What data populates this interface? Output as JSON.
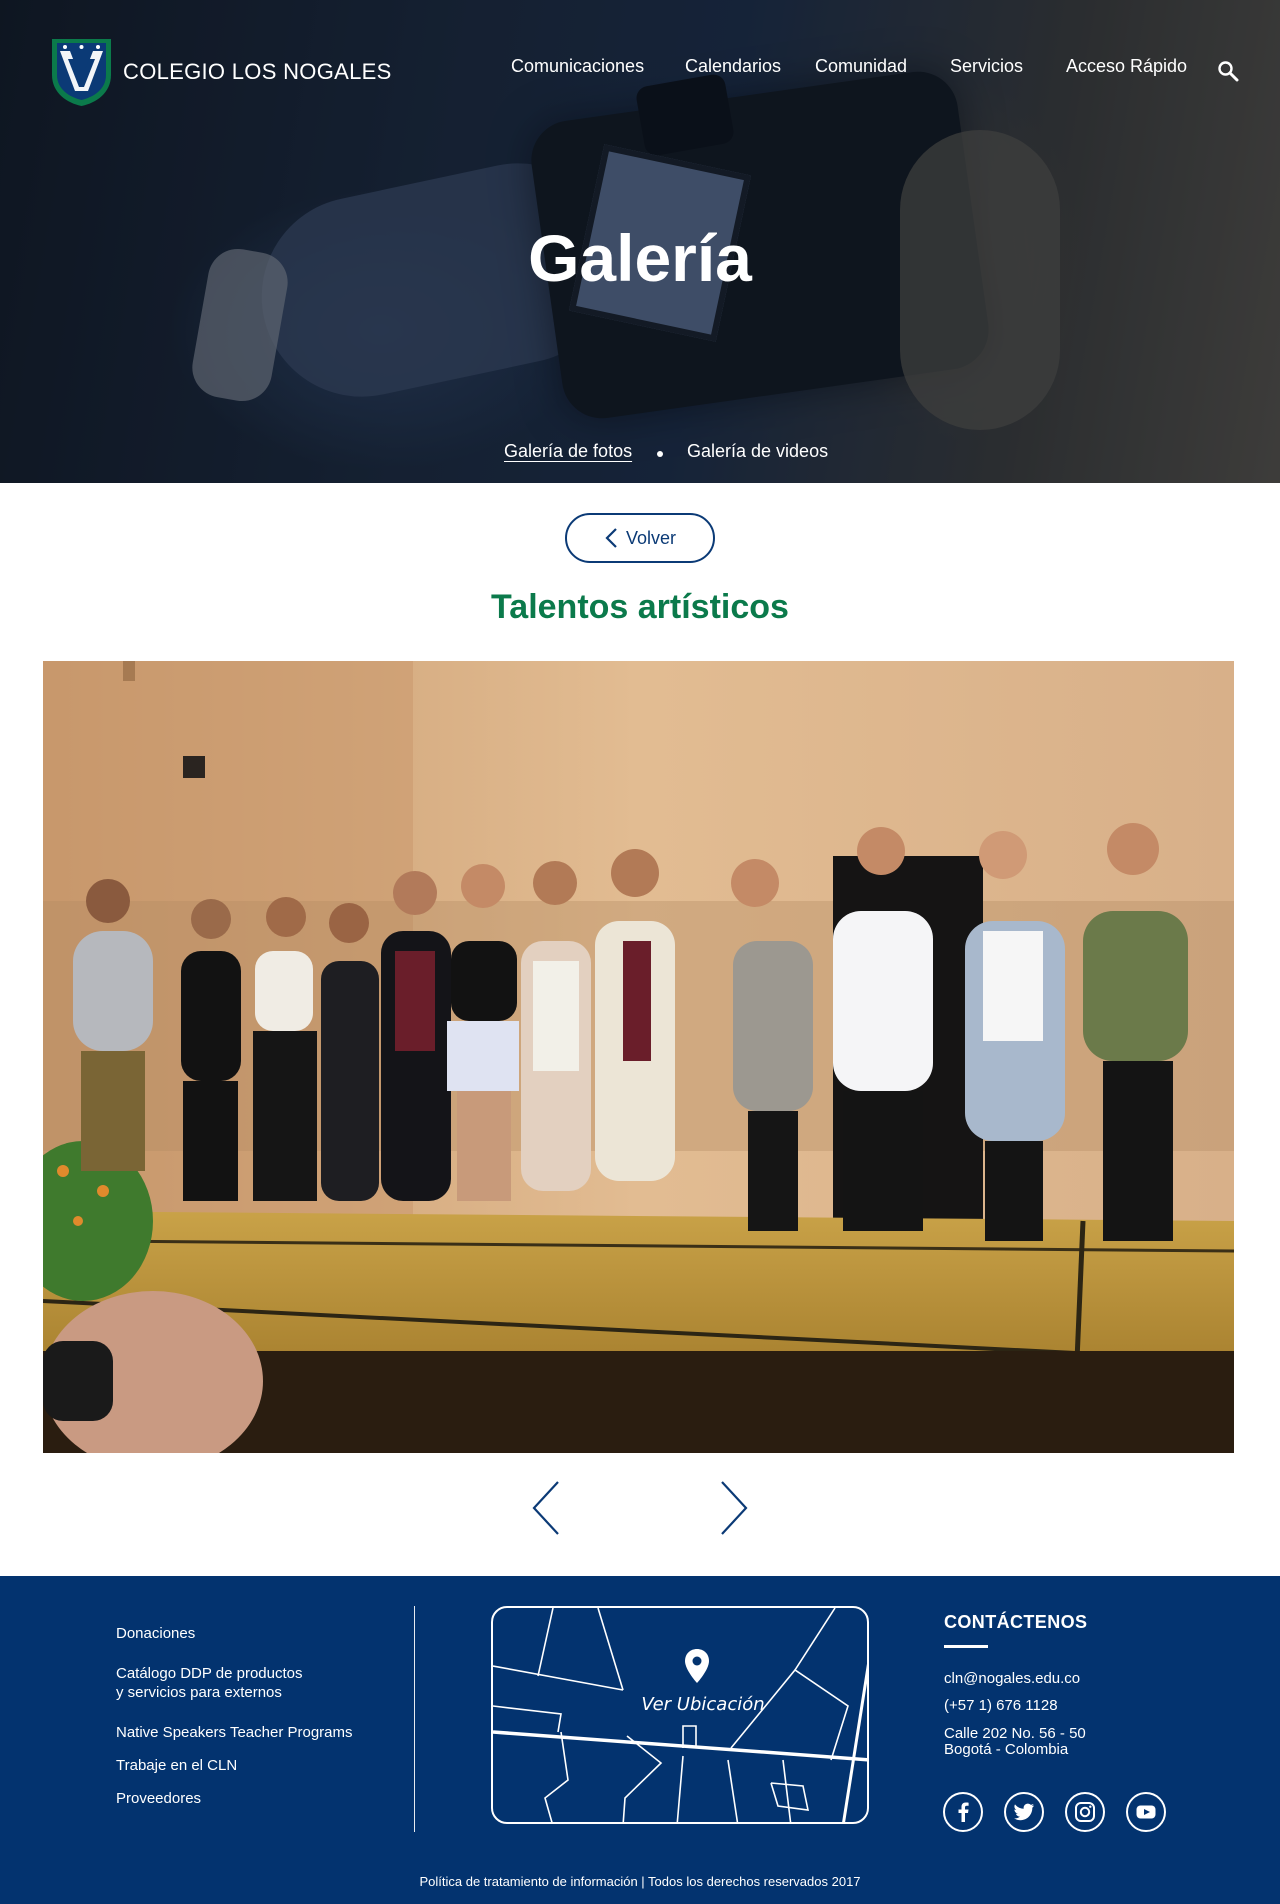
{
  "brand": {
    "name": "COLEGIO LOS NOGALES",
    "crest_color": "#0b7a4b",
    "crest_inner": "#0b3a76"
  },
  "nav": {
    "items": [
      "Comunicaciones",
      "Calendarios",
      "Comunidad",
      "Servicios",
      "Acceso Rápido"
    ]
  },
  "hero": {
    "title": "Galería"
  },
  "subnav": {
    "photos": "Galería de fotos",
    "videos": "Galería de videos"
  },
  "back_button": {
    "label": "Volver"
  },
  "album": {
    "title": "Talentos artísticos"
  },
  "footer": {
    "links": [
      "Donaciones",
      "Catálogo DDP de productos",
      "y servicios para externos",
      "Native Speakers Teacher Programs",
      "Trabaje en el CLN",
      "Proveedores"
    ],
    "map_label": "Ver Ubicación",
    "contact": {
      "title": "CONTÁCTENOS",
      "email": "cln@nogales.edu.co",
      "phone": "(+57 1) 676 1128",
      "address_line1": "Calle 202 No. 56 - 50",
      "address_line2": "Bogotá - Colombia"
    },
    "social_icons": [
      "facebook-icon",
      "twitter-icon",
      "instagram-icon",
      "youtube-icon"
    ],
    "legal": "Política de tratamiento de información | Todos los derechos reservados 2017"
  },
  "colors": {
    "navy": "#0b3a76",
    "footer_bg": "#03336f",
    "green_accent": "#0b7a4b"
  }
}
